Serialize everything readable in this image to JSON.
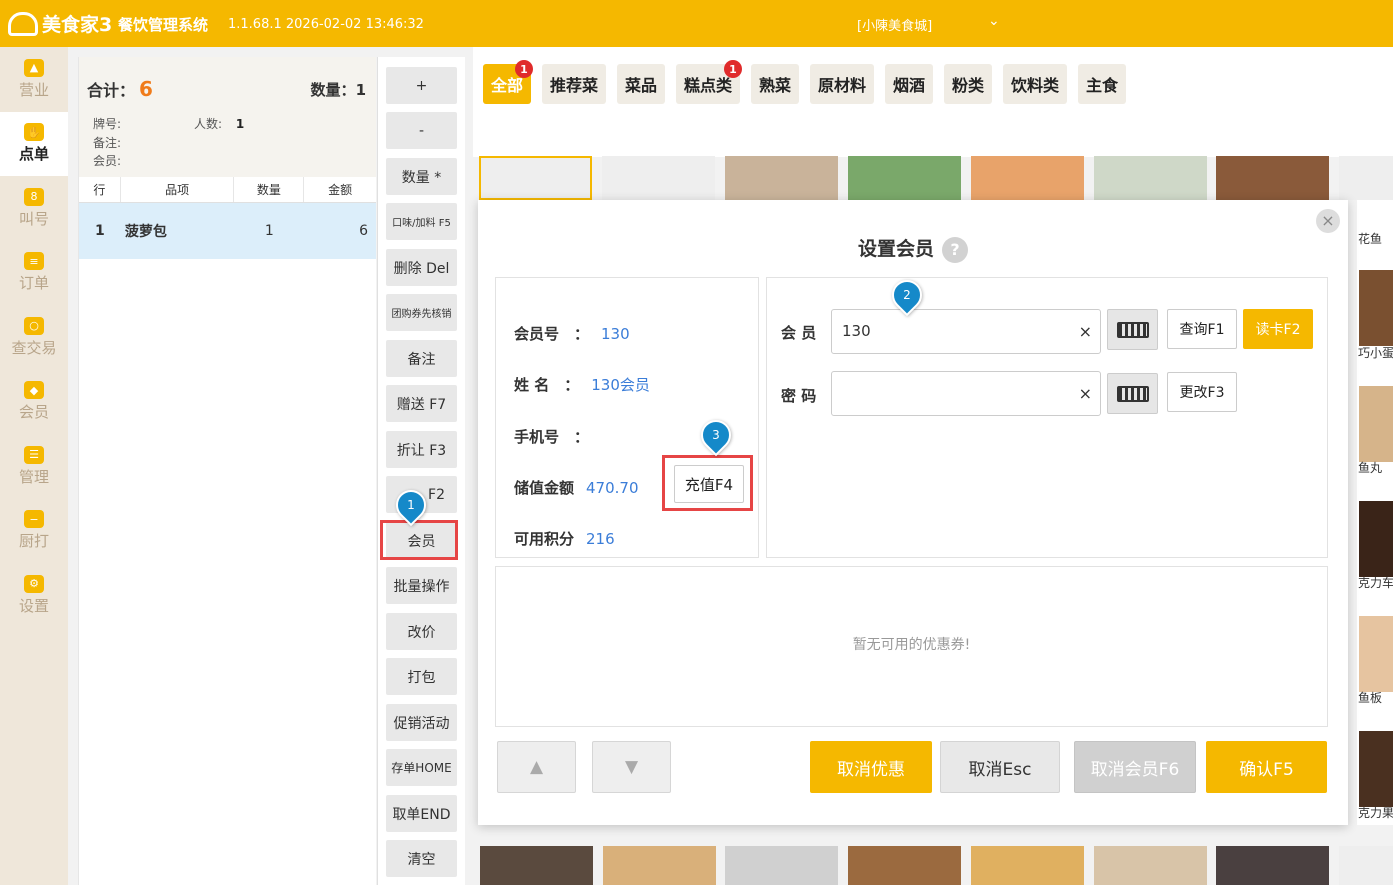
{
  "app": {
    "logo_text": "美食家3",
    "system_name": "餐饮管理系统",
    "version_time": "1.1.68.1 2026-02-02 13:46:32",
    "store": "[小陳美食城]"
  },
  "nav": [
    {
      "label": "营业",
      "icon": "chart-icon"
    },
    {
      "label": "点单",
      "icon": "hand-icon"
    },
    {
      "label": "叫号",
      "icon": "number-icon"
    },
    {
      "label": "订单",
      "icon": "list-icon"
    },
    {
      "label": "查交易",
      "icon": "search-icon"
    },
    {
      "label": "会员",
      "icon": "diamond-icon"
    },
    {
      "label": "管理",
      "icon": "manage-icon"
    },
    {
      "label": "厨打",
      "icon": "printer-icon"
    },
    {
      "label": "设置",
      "icon": "gear-icon"
    }
  ],
  "order": {
    "total_label": "合计：",
    "total_value": "6",
    "qty_label": "数量：",
    "qty_value": "1",
    "table_label": "牌号:",
    "people_label": "人数:",
    "people_value": "1",
    "note_label": "备注:",
    "member_label": "会员:",
    "columns": [
      "行",
      "品项",
      "数量",
      "金额"
    ],
    "rows": [
      {
        "line": "1",
        "name": "菠萝包",
        "qty": "1",
        "amount": "6"
      }
    ]
  },
  "functions": [
    "+",
    "-",
    "数量 *",
    "口味/加料 F5",
    "删除 Del",
    "团购券先核销",
    "备注",
    "赠送 F7",
    "折让 F3",
    "F2",
    "会员",
    "批量操作",
    "改价",
    "打包",
    "促销活动",
    "存单HOME",
    "取单END",
    "清空"
  ],
  "categories": [
    {
      "label": "全部",
      "badge": "1"
    },
    {
      "label": "推荐菜",
      "badge": ""
    },
    {
      "label": "菜品",
      "badge": ""
    },
    {
      "label": "糕点类",
      "badge": "1"
    },
    {
      "label": "熟菜",
      "badge": ""
    },
    {
      "label": "原材料",
      "badge": ""
    },
    {
      "label": "烟酒",
      "badge": ""
    },
    {
      "label": "粉类",
      "badge": ""
    },
    {
      "label": "饮料类",
      "badge": ""
    },
    {
      "label": "主食",
      "badge": ""
    }
  ],
  "modal": {
    "title": "设置会员",
    "help": "?",
    "close": "×",
    "member_no_label": "会员号　：",
    "member_no": "130",
    "name_label": "姓  名　：",
    "name": "130会员",
    "phone_label": "手机号　：",
    "phone": "",
    "balance_label": "储值金额",
    "balance": "470.70",
    "points_label": "可用积分",
    "points": "216",
    "recharge_button": "充值F4",
    "member_field_label": "会  员",
    "member_field_value": "130",
    "password_field_label": "密  码",
    "password_field_value": "",
    "clear": "×",
    "query_button": "查询F1",
    "read_card_button": "读卡F2",
    "change_button": "更改F3",
    "no_coupons": "暂无可用的优惠券!",
    "cancel_discount": "取消优惠",
    "cancel_esc": "取消Esc",
    "cancel_member": "取消会员F6",
    "confirm": "确认F5"
  },
  "markers": [
    "1",
    "2",
    "3"
  ],
  "right_labels": [
    "花鱼",
    "巧小蛋",
    "鱼丸",
    "克力车",
    "鱼板",
    "克力果"
  ],
  "colors": {
    "accent": "#f5b800",
    "highlight": "#e64545",
    "link": "#3b7dd8",
    "marker": "#1589c9"
  }
}
